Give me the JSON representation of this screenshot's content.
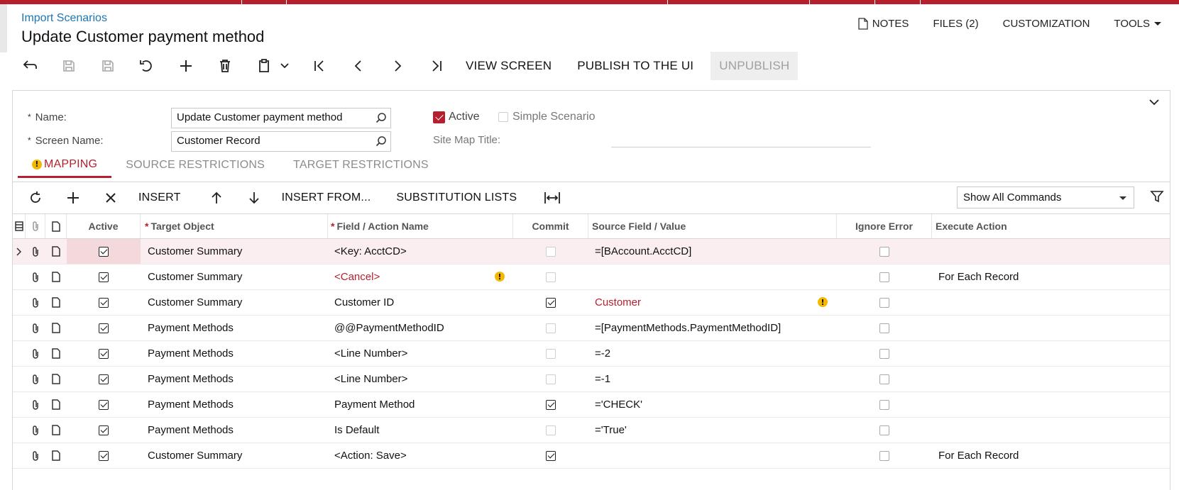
{
  "breadcrumb": "Import Scenarios",
  "page_title": "Update Customer payment method",
  "top_menu": {
    "notes": "NOTES",
    "files": "FILES (2)",
    "customization": "CUSTOMIZATION",
    "tools": "TOOLS"
  },
  "toolbar": {
    "view_screen": "VIEW SCREEN",
    "publish": "PUBLISH TO THE UI",
    "unpublish": "UNPUBLISH"
  },
  "form": {
    "name_label": "Name:",
    "name_value": "Update Customer payment method",
    "screen_name_label": "Screen Name:",
    "screen_name_value": "Customer Record",
    "active_label": "Active",
    "active_checked": true,
    "simple_scenario_label": "Simple Scenario",
    "simple_scenario_checked": false,
    "site_map_title_label": "Site Map Title:",
    "site_map_title_value": ""
  },
  "tabs": [
    {
      "label": "MAPPING",
      "active": true,
      "warning": true
    },
    {
      "label": "SOURCE RESTRICTIONS",
      "active": false
    },
    {
      "label": "TARGET RESTRICTIONS",
      "active": false
    }
  ],
  "grid_toolbar": {
    "insert": "INSERT",
    "insert_from": "INSERT FROM...",
    "substitution_lists": "SUBSTITUTION LISTS",
    "commands_select": "Show All Commands"
  },
  "grid": {
    "headers": {
      "active": "Active",
      "target_object": "Target Object",
      "field_action": "Field / Action Name",
      "commit": "Commit",
      "source_field": "Source Field / Value",
      "ignore_error": "Ignore Error",
      "execute_action": "Execute Action"
    },
    "rows": [
      {
        "active": true,
        "target": "Customer Summary",
        "field": "<Key: AcctCD>",
        "commit": false,
        "source": "=[BAccount.AcctCD]",
        "ignore": false,
        "execute": ""
      },
      {
        "active": true,
        "target": "Customer Summary",
        "field": "<Cancel>",
        "commit": false,
        "source": "",
        "ignore": false,
        "execute": "For Each Record"
      },
      {
        "active": true,
        "target": "Customer Summary",
        "field": "Customer ID",
        "commit": true,
        "source": "Customer",
        "ignore": false,
        "execute": ""
      },
      {
        "active": true,
        "target": "Payment Methods",
        "field": "@@PaymentMethodID",
        "commit": false,
        "source": "=[PaymentMethods.PaymentMethodID]",
        "ignore": false,
        "execute": ""
      },
      {
        "active": true,
        "target": "Payment Methods",
        "field": "<Line Number>",
        "commit": false,
        "source": "=-2",
        "ignore": false,
        "execute": ""
      },
      {
        "active": true,
        "target": "Payment Methods",
        "field": "<Line Number>",
        "commit": false,
        "source": "=-1",
        "ignore": false,
        "execute": ""
      },
      {
        "active": true,
        "target": "Payment Methods",
        "field": "Payment Method",
        "commit": true,
        "source": "='CHECK'",
        "ignore": false,
        "execute": ""
      },
      {
        "active": true,
        "target": "Payment Methods",
        "field": "Is Default",
        "commit": false,
        "source": "='True'",
        "ignore": false,
        "execute": ""
      },
      {
        "active": true,
        "target": "Customer Summary",
        "field": "<Action: Save>",
        "commit": true,
        "source": "",
        "ignore": false,
        "execute": "For Each Record"
      }
    ]
  },
  "colors": {
    "brand_red": "#b5202e",
    "link_blue": "#1d76b5",
    "warning_yellow": "#f5b800",
    "selected_row": "#fbeef0"
  }
}
